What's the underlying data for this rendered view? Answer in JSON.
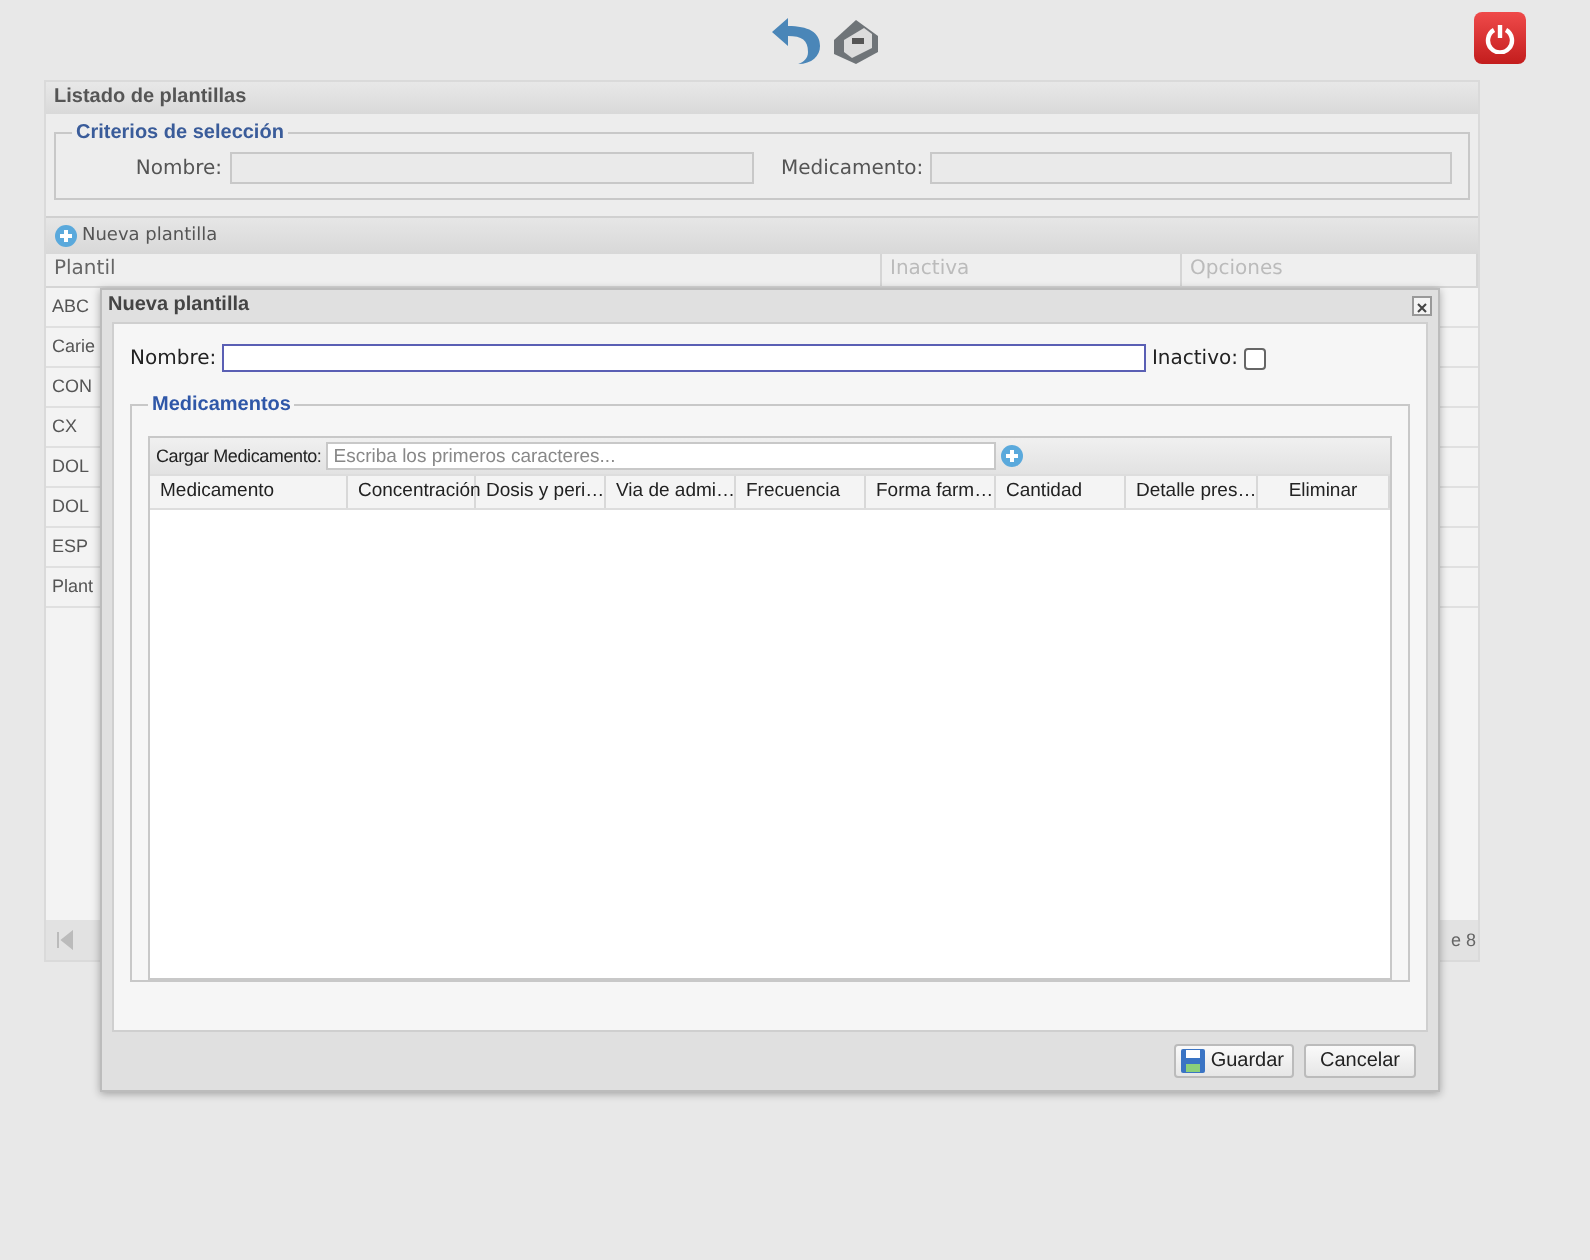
{
  "list_panel": {
    "title": "Listado de plantillas",
    "criteria": {
      "legend": "Criterios de selección",
      "fields": [
        {
          "label": "Nombre:"
        },
        {
          "label": "Medicamento:"
        }
      ]
    },
    "new_button": "Nueva plantilla",
    "table": {
      "columns": [
        "Plantil",
        "Inactiva",
        "Opciones"
      ],
      "rows": [
        "ABC",
        "Carie",
        "CON",
        "CX",
        "DOL",
        "DOL",
        "ESP",
        "Plant"
      ]
    },
    "pager": {
      "text": "e 8"
    }
  },
  "dialog": {
    "title": "Nueva plantilla",
    "name_label": "Nombre:",
    "inactive_label": "Inactivo:",
    "inactive_checked": false,
    "medications": {
      "legend": "Medicamentos",
      "load_label": "Cargar Medicamento:",
      "load_placeholder": "Escriba los primeros caracteres...",
      "columns": [
        "Medicamento",
        "Concentración",
        "Dosis y peri…",
        "Via de admi…",
        "Frecuencia",
        "Forma farm…",
        "Cantidad",
        "Detalle pres…",
        "Eliminar"
      ]
    },
    "buttons": [
      {
        "label": "Guardar",
        "kind": "save"
      },
      {
        "label": "Cancelar",
        "kind": "cancel"
      }
    ]
  }
}
